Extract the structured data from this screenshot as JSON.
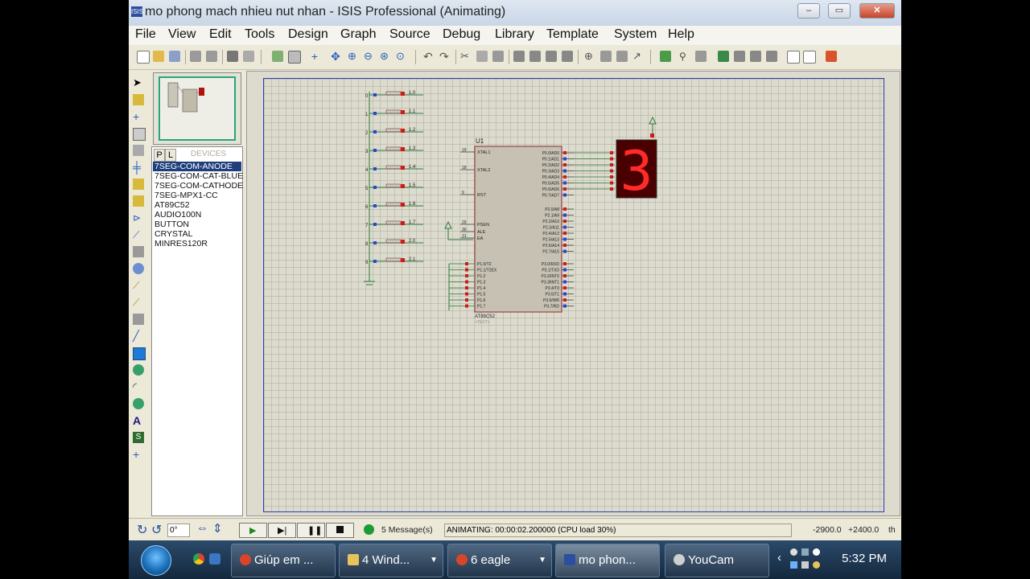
{
  "window": {
    "title": "mo phong mach nhieu nut nhan - ISIS Professional (Animating)",
    "app_icon": "ISIS"
  },
  "menu": [
    "File",
    "View",
    "Edit",
    "Tools",
    "Design",
    "Graph",
    "Source",
    "Debug",
    "Library",
    "Template",
    "System",
    "Help"
  ],
  "device_panel": {
    "tab_p": "P",
    "tab_l": "L",
    "header": "DEVICES",
    "items": [
      "7SEG-COM-ANODE",
      "7SEG-COM-CAT-BLUE",
      "7SEG-COM-CATHODE",
      "7SEG-MPX1-CC",
      "AT89C52",
      "AUDIO100N",
      "BUTTON",
      "CRYSTAL",
      "MINRES120R"
    ],
    "selected": "7SEG-COM-ANODE"
  },
  "schematic": {
    "chip_ref": "U1",
    "chip_name": "AT89C52",
    "chip_sub": "<TEXT>",
    "seg_digit": "3",
    "left_pins": [
      {
        "num": "19",
        "name": "XTAL1"
      },
      {
        "num": "18",
        "name": "XTAL2"
      },
      {
        "num": "9",
        "name": "RST"
      },
      {
        "num": "29",
        "name": "PSEN"
      },
      {
        "num": "30",
        "name": "ALE"
      },
      {
        "num": "31",
        "name": "EA"
      }
    ],
    "p1_pins": [
      "P1.0/T2",
      "P1.1/T2EX",
      "P1.2",
      "P1.3",
      "P1.4",
      "P1.5",
      "P1.6",
      "P1.7"
    ],
    "p0_pins": [
      "P0.0/AD0",
      "P0.1/AD1",
      "P0.2/AD2",
      "P0.3/AD3",
      "P0.4/AD4",
      "P0.5/AD5",
      "P0.6/AD6",
      "P0.7/AD7"
    ],
    "p2_pins": [
      "P2.0/A8",
      "P2.1/A9",
      "P2.2/A10",
      "P2.3/A11",
      "P2.4/A12",
      "P2.5/A13",
      "P2.6/A14",
      "P2.7/A15"
    ],
    "p3_pins": [
      "P3.0/RXD",
      "P3.1/TXD",
      "P3.2/INT0",
      "P3.3/INT1",
      "P3.4/T0",
      "P3.5/T1",
      "P3.6/WR",
      "P3.7/RD"
    ],
    "button_labels": [
      "1.0",
      "1.1",
      "1.2",
      "1.3",
      "1.4",
      "1.5",
      "1.6",
      "1.7",
      "2.0",
      "2.1"
    ],
    "button_nums": [
      "0",
      "1",
      "2",
      "3",
      "4",
      "5",
      "6",
      "7",
      "8",
      "9"
    ]
  },
  "status": {
    "rotation": "0°",
    "messages": "5 Message(s)",
    "animating": "ANIMATING: 00:00:02.200000 (CPU load 30%)",
    "coord_x": "-2900.0",
    "coord_y": "+2400.0",
    "units": "th"
  },
  "taskbar": {
    "items": [
      {
        "label": "Giúp em ...",
        "icon": "chrome-icon",
        "color": "#d9452b"
      },
      {
        "label": "4 Wind...",
        "icon": "folder-icon",
        "color": "#e8c35a"
      },
      {
        "label": "6 eagle",
        "icon": "eagle-icon",
        "color": "#d9452b"
      },
      {
        "label": "mo phon...",
        "icon": "isis-icon",
        "color": "#2a4f9e"
      },
      {
        "label": "YouCam",
        "icon": "camera-icon",
        "color": "#cfcfcf"
      }
    ],
    "clock": "5:32 PM"
  },
  "colors": {
    "accent": "#1f3f7c",
    "segment": "#d11a1a",
    "frame": "#2b3eb0"
  }
}
